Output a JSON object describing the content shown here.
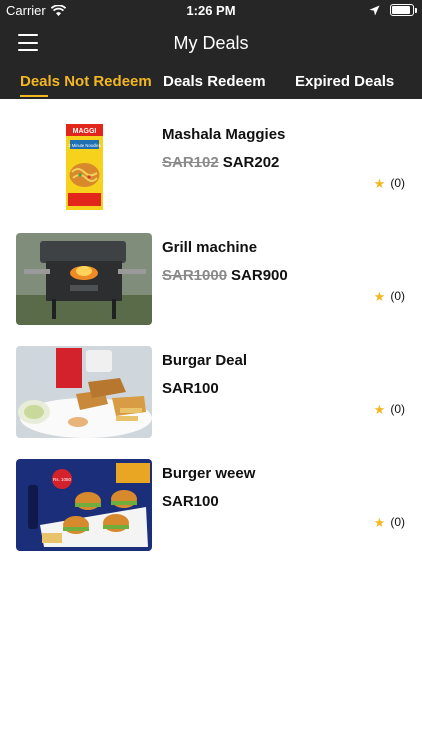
{
  "status_bar": {
    "carrier": "Carrier",
    "time": "1:26 PM"
  },
  "header": {
    "title": "My Deals"
  },
  "tabs": [
    {
      "label": "Deals Not Redeem",
      "active": true
    },
    {
      "label": "Deals Redeem",
      "active": false
    },
    {
      "label": "Expired Deals",
      "active": false
    }
  ],
  "deals": [
    {
      "title": "Mashala Maggies",
      "old_price": "SAR102",
      "price": "SAR202",
      "rating": "(0)",
      "image": "maggi-packet"
    },
    {
      "title": "Grill machine",
      "old_price": "SAR1000",
      "price": "SAR900",
      "rating": "(0)",
      "image": "grill"
    },
    {
      "title": "Burgar Deal",
      "old_price": "",
      "price": "SAR100",
      "rating": "(0)",
      "image": "chicken-meal"
    },
    {
      "title": "Burger weew",
      "old_price": "",
      "price": "SAR100",
      "rating": "(0)",
      "image": "burger-combo"
    }
  ],
  "image_text": {
    "maggi_brand": "MAGGI",
    "maggi_variant": "2 Minute Noodles",
    "burger_promo": "Rs. 1050"
  },
  "colors": {
    "header_bg": "#262626",
    "accent": "#f3b722",
    "strike": "#8a8a8a"
  }
}
